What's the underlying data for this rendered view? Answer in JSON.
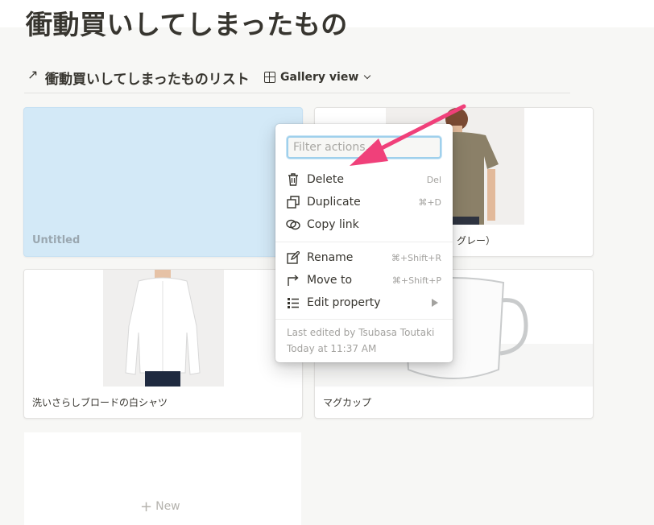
{
  "page": {
    "title": "衝動買いしてしまったもの"
  },
  "database": {
    "link_glyph": "↗",
    "title": "衝動買いしてしまったものリスト",
    "view_label": "Gallery view"
  },
  "cards": [
    {
      "caption": "Untitled",
      "selected": true
    },
    {
      "caption": "グレー）"
    },
    {
      "caption": "洗いさらしブロードの白シャツ"
    },
    {
      "caption": "マグカップ"
    }
  ],
  "new_card": {
    "plus": "+",
    "label": "New"
  },
  "context_menu": {
    "filter_placeholder": "Filter actions...",
    "items": [
      {
        "label": "Delete",
        "shortcut": "Del",
        "icon": "trash-icon"
      },
      {
        "label": "Duplicate",
        "shortcut": "⌘+D",
        "icon": "duplicate-icon"
      },
      {
        "label": "Copy link",
        "shortcut": "",
        "icon": "link-icon"
      },
      {
        "label": "Rename",
        "shortcut": "⌘+Shift+R",
        "icon": "rename-icon"
      },
      {
        "label": "Move to",
        "shortcut": "⌘+Shift+P",
        "icon": "move-to-icon"
      },
      {
        "label": "Edit property",
        "shortcut": "",
        "icon": "list-icon"
      }
    ],
    "last_edited": "Last edited by Tsubasa Toutaki",
    "edited_time": "Today at 11:37 AM"
  },
  "colors": {
    "selection": "#d3e9f7",
    "annotation_arrow": "#f0407a",
    "focus_ring": "#9fd0ec"
  }
}
